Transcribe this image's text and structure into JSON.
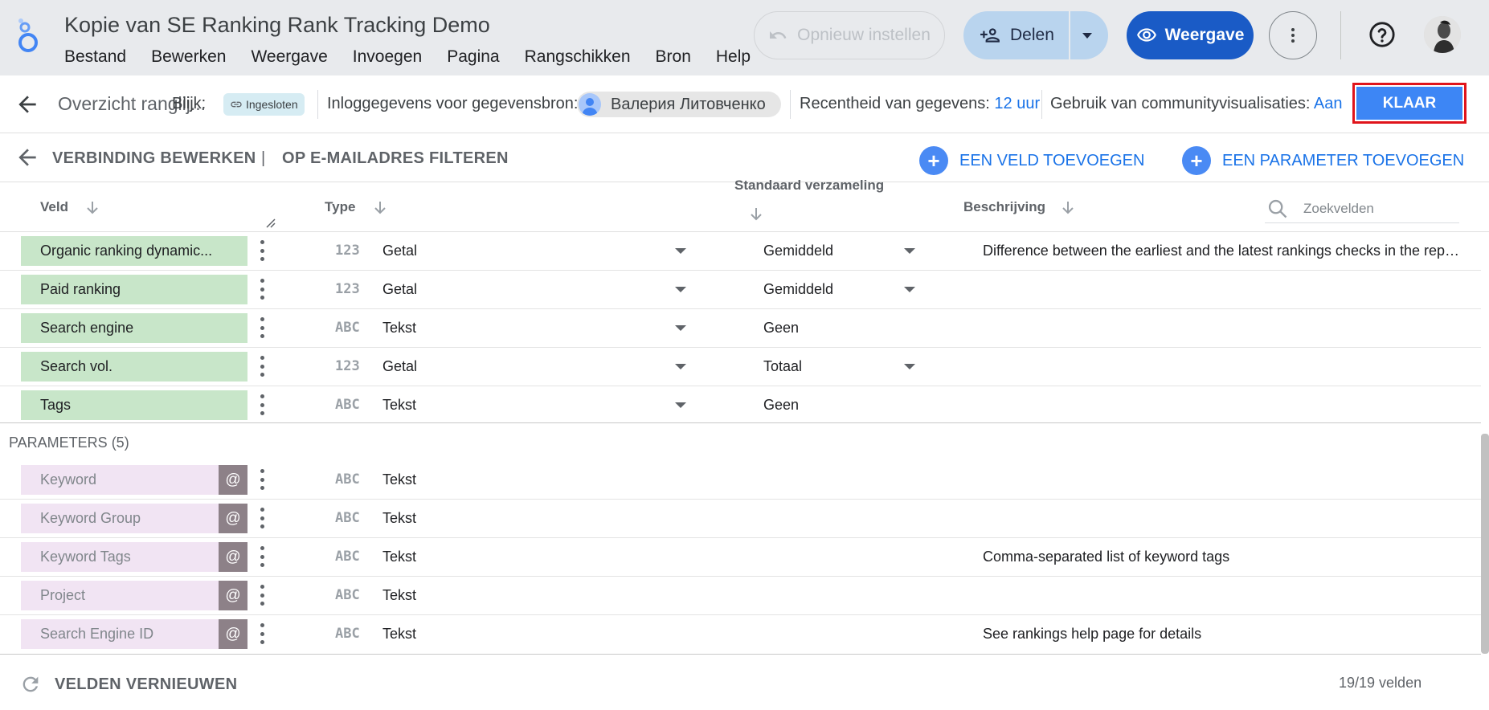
{
  "app": {
    "title": "Kopie van SE Ranking Rank Tracking Demo",
    "menu": [
      "Bestand",
      "Bewerken",
      "Weergave",
      "Invoegen",
      "Pagina",
      "Rangschikken",
      "Bron",
      "Help"
    ],
    "reset_label": "Opnieuw instellen",
    "share_label": "Delen",
    "view_label": "Weergave"
  },
  "toolbar": {
    "datasource_title": "Overzicht ranglij...",
    "access_label": "Blijk:",
    "access_chip": "Ingesloten",
    "credentials_label": "Inloggegevens voor gegevensbron:",
    "credentials_user": "Валерия Литовченко",
    "freshness_label": "Recentheid van gegevens:",
    "freshness_value": "12 uur",
    "community_label": "Gebruik van communityvisualisaties:",
    "community_value": "Aan",
    "done_label": "KLAAR"
  },
  "connection": {
    "edit_label": "VERBINDING BEWERKEN",
    "separator": "|",
    "filter_label": "OP E-MAILADRES FILTEREN",
    "add_field_label": "EEN VELD TOEVOEGEN",
    "add_param_label": "EEN PARAMETER TOEVOEGEN"
  },
  "columns": {
    "field": "Veld",
    "type": "Type",
    "aggregation": "Standaard verzameling",
    "description": "Beschrijving",
    "search_placeholder": "Zoekvelden"
  },
  "fields": [
    {
      "name": "Organic ranking dynamic...",
      "type_icon": "123",
      "type": "Getal",
      "aggregation": "Gemiddeld",
      "agg_dropdown": true,
      "description": "Difference between the earliest and the latest rankings checks in the repo..."
    },
    {
      "name": "Paid ranking",
      "type_icon": "123",
      "type": "Getal",
      "aggregation": "Gemiddeld",
      "agg_dropdown": true,
      "description": ""
    },
    {
      "name": "Search engine",
      "type_icon": "ABC",
      "type": "Tekst",
      "aggregation": "Geen",
      "agg_dropdown": false,
      "description": ""
    },
    {
      "name": "Search vol.",
      "type_icon": "123",
      "type": "Getal",
      "aggregation": "Totaal",
      "agg_dropdown": true,
      "description": ""
    },
    {
      "name": "Tags",
      "type_icon": "ABC",
      "type": "Tekst",
      "aggregation": "Geen",
      "agg_dropdown": false,
      "description": ""
    }
  ],
  "parameters_header": "PARAMETERS (5)",
  "parameters": [
    {
      "name": "Keyword",
      "type_icon": "ABC",
      "type": "Tekst",
      "description": ""
    },
    {
      "name": "Keyword Group",
      "type_icon": "ABC",
      "type": "Tekst",
      "description": ""
    },
    {
      "name": "Keyword Tags",
      "type_icon": "ABC",
      "type": "Tekst",
      "description": "Comma-separated list of keyword tags"
    },
    {
      "name": "Project",
      "type_icon": "ABC",
      "type": "Tekst",
      "description": ""
    },
    {
      "name": "Search Engine ID",
      "type_icon": "ABC",
      "type": "Tekst",
      "description": "See rankings help page for details"
    }
  ],
  "param_badge": "@",
  "footer": {
    "refresh_label": "VELDEN VERNIEUWEN",
    "count": "19/19 velden"
  },
  "colors": {
    "done_button": "#3d86f5",
    "field_chip": "#c8e6c9",
    "param_chip": "#f1e4f3",
    "link": "#1a73e8"
  }
}
